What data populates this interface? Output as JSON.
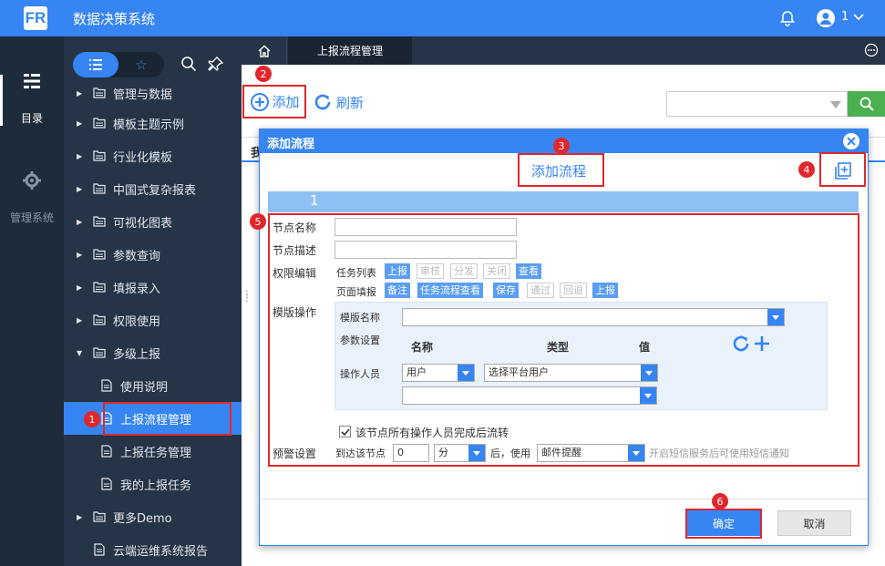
{
  "app": {
    "title": "数据决策系统",
    "logo_text": "FR",
    "user": "1"
  },
  "rail": {
    "items": [
      {
        "label": "目录"
      },
      {
        "label": "管理系统"
      }
    ]
  },
  "tree": {
    "items": [
      {
        "label": "管理与数据"
      },
      {
        "label": "模板主题示例"
      },
      {
        "label": "行业化模板"
      },
      {
        "label": "中国式复杂报表"
      },
      {
        "label": "可视化图表"
      },
      {
        "label": "参数查询"
      },
      {
        "label": "填报录入"
      },
      {
        "label": "权限使用"
      },
      {
        "label": "多级上报"
      },
      {
        "label": "使用说明"
      },
      {
        "label": "上报流程管理"
      },
      {
        "label": "上报任务管理"
      },
      {
        "label": "我的上报任务"
      },
      {
        "label": "更多Demo"
      },
      {
        "label": "云端运维系统报告"
      }
    ]
  },
  "tabs": {
    "active": "上报流程管理"
  },
  "toolbar": {
    "add": "添加",
    "refresh": "刷新",
    "grid_head_partial": "我"
  },
  "badges": [
    "1",
    "2",
    "3",
    "4",
    "5",
    "6"
  ],
  "dialog": {
    "title": "添加流程",
    "form_title": "添加流程",
    "step": "1",
    "node_name_label": "节点名称",
    "node_desc_label": "节点描述",
    "perm_label": "权限编辑",
    "task_list_label": "任务列表",
    "task_list_tags": [
      {
        "text": "上报",
        "on": true
      },
      {
        "text": "审核",
        "on": false
      },
      {
        "text": "分发",
        "on": false
      },
      {
        "text": "关闭",
        "on": false
      },
      {
        "text": "查看",
        "on": true
      }
    ],
    "page_fill_label": "页面填报",
    "page_fill_tags": [
      {
        "text": "备注",
        "on": true
      },
      {
        "text": "任务流程查看",
        "on": true
      },
      {
        "text": "保存",
        "on": true
      },
      {
        "text": "通过",
        "on": false
      },
      {
        "text": "回退",
        "on": false
      },
      {
        "text": "上报",
        "on": true
      }
    ],
    "template_label": "模版操作",
    "template_name_label": "模版名称",
    "param_label": "参数设置",
    "col_name": "名称",
    "col_type": "类型",
    "col_value": "值",
    "operator_label": "操作人员",
    "operator_type": "用户",
    "operator_select": "选择平台用户",
    "checkbox_label": "该节点所有操作人员完成后流转",
    "warn_label": "预警设置",
    "warn_prefix": "到达该节点",
    "warn_value": "0",
    "warn_unit": "分",
    "warn_mid": "后，使用",
    "warn_method": "邮件提醒",
    "warn_hint": "开启短信服务后可使用短信通知",
    "ok": "确定",
    "cancel": "取消"
  },
  "colors": {
    "primary": "#3685f2",
    "topbar": "#3685f2",
    "rail": "#1e2b3b",
    "tree": "#253447",
    "annotation": "#e0272b",
    "search_button": "#4caf50"
  }
}
